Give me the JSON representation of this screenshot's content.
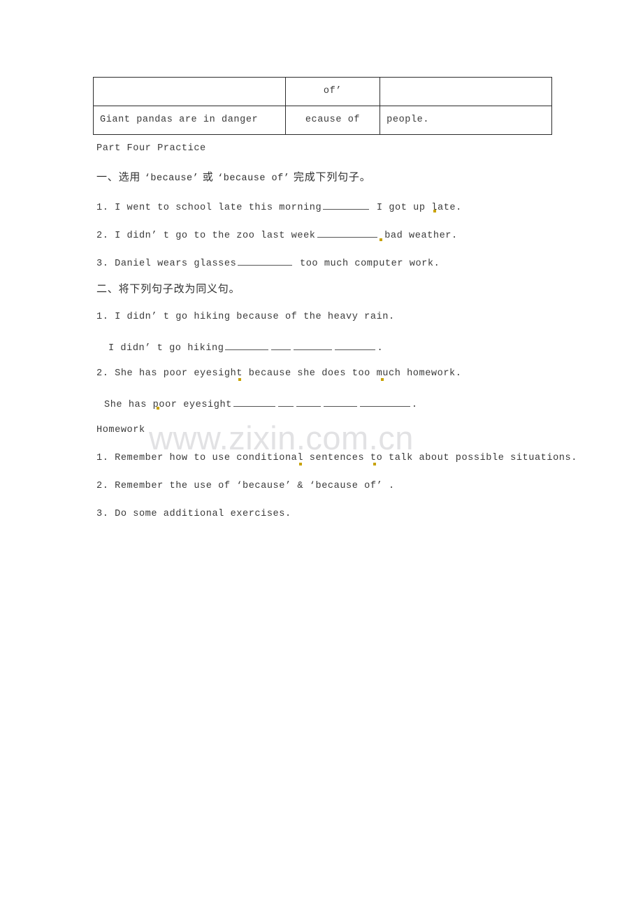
{
  "watermark": {
    "text": "www.zixin.com.cn"
  },
  "table": {
    "rows": [
      {
        "cells": [
          "",
          "of’",
          ""
        ]
      },
      {
        "cells": [
          "Giant pandas are in danger",
          "ecause of",
          "people."
        ]
      }
    ]
  },
  "part_heading": "Part Four Practice",
  "section_one": {
    "heading": {
      "prefix": "一、选用 ",
      "quote1": "‘because’",
      "middle": " 或 ",
      "quote2": "‘because of’",
      "suffix": " 完成下列句子。"
    },
    "items": [
      {
        "num": "1.",
        "before": "I went to school late this morning",
        "blank_w": 66,
        "after": "I got up late."
      },
      {
        "num": "2.",
        "before": "I didn’ t go to the zoo last week",
        "blank_w": 86,
        "after": "bad weather."
      },
      {
        "num": "3.",
        "before": "Daniel wears glasses",
        "blank_w": 78,
        "after": "too much computer work."
      }
    ]
  },
  "section_two": {
    "heading": "二、将下列句子改为同义句。",
    "items": [
      {
        "num": "1.",
        "source": "I didn’ t go hiking because of the heavy rain.",
        "answer_prefix": "I didn’ t go hiking",
        "blanks": [
          62,
          28,
          55,
          58
        ],
        "answer_suffix": "."
      },
      {
        "num": "2.",
        "source": "She has poor eyesight because she does too much homework.",
        "answer_prefix": "She has poor eyesight",
        "blanks": [
          60,
          22,
          35,
          48,
          72
        ],
        "answer_suffix": "."
      }
    ]
  },
  "homework": {
    "heading": "Homework",
    "items": [
      {
        "num": "1.",
        "text": "Remember how to use conditional sentences to talk about possible situations."
      },
      {
        "num": "2.",
        "text": "Remember the use of  ‘because’  &  ‘because of’ ."
      },
      {
        "num": "3.",
        "text": "Do some additional exercises."
      }
    ]
  }
}
